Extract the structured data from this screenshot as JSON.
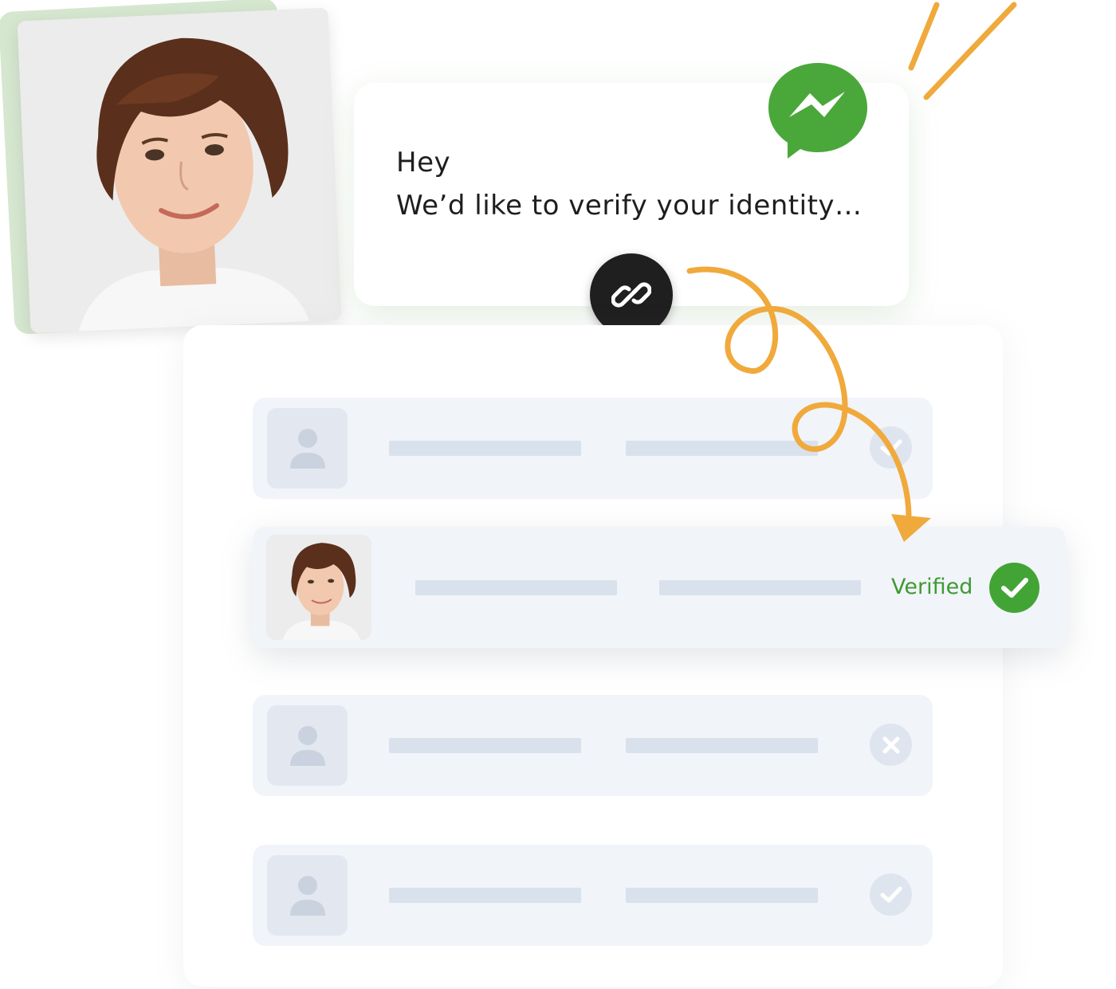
{
  "message": {
    "line1": "Hey",
    "line2": "We’d like to verify your identity…"
  },
  "icons": {
    "messenger": "messenger-bubble-icon",
    "link": "link-chain-icon",
    "user": "user-silhouette-icon",
    "check": "check-icon",
    "close": "x-icon"
  },
  "list": {
    "rows": [
      {
        "status": "verified-faded"
      },
      {
        "status": "verified",
        "label": "Verified"
      },
      {
        "status": "rejected"
      },
      {
        "status": "verified-faded"
      }
    ],
    "featured_label": "Verified"
  },
  "colors": {
    "brand_green": "#43a436",
    "messenger_green": "#4aa83a",
    "accent_orange": "#f0a93b",
    "row_bg": "#f1f4f9",
    "placeholder_bar": "#d9e1ec"
  }
}
